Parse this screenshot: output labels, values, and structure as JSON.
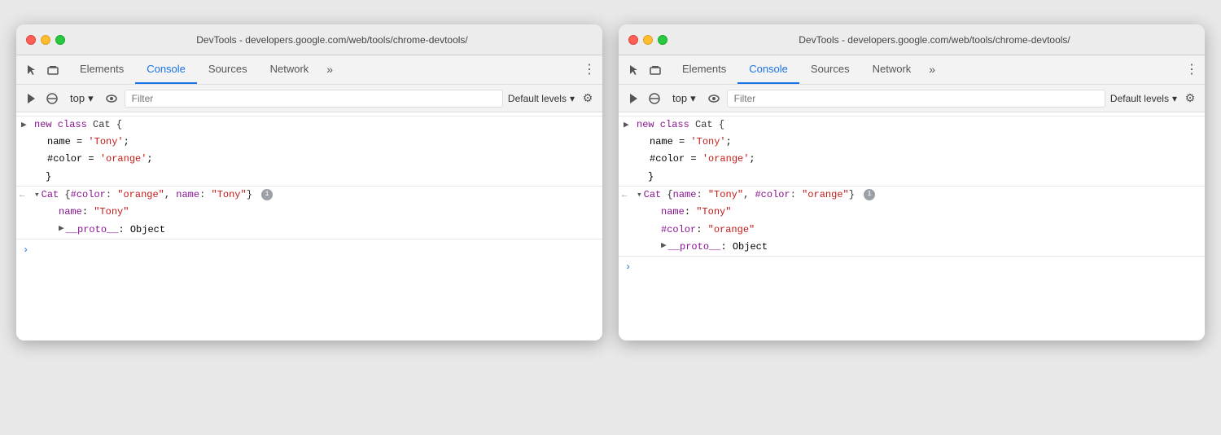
{
  "windows": [
    {
      "id": "window-left",
      "title_bar": {
        "title": "DevTools - developers.google.com/web/tools/chrome-devtools/"
      },
      "tabs": {
        "items": [
          {
            "id": "elements",
            "label": "Elements",
            "active": false
          },
          {
            "id": "console",
            "label": "Console",
            "active": true
          },
          {
            "id": "sources",
            "label": "Sources",
            "active": false
          },
          {
            "id": "network",
            "label": "Network",
            "active": false
          }
        ],
        "more_label": "»"
      },
      "toolbar": {
        "context_label": "top",
        "filter_placeholder": "Filter",
        "levels_label": "Default levels",
        "levels_arrow": "▾"
      },
      "console": {
        "input_lines": [
          "> new class Cat {",
          "    name = 'Tony';",
          "    #color = 'orange';",
          "  }"
        ],
        "output": {
          "arrow": "<",
          "expanded": true,
          "obj_preview_left": "▾Cat {#color: ",
          "obj_color_val": "\"orange\"",
          "obj_preview_mid": ", name: ",
          "obj_name_val": "\"Tony\"",
          "obj_preview_right": "}",
          "children": [
            {
              "key": "name",
              "value": "\"Tony\"",
              "value_type": "string"
            },
            {
              "proto_prefix": "▶",
              "proto_key": "__proto__",
              "proto_value": "Object"
            }
          ]
        }
      }
    },
    {
      "id": "window-right",
      "title_bar": {
        "title": "DevTools - developers.google.com/web/tools/chrome-devtools/"
      },
      "tabs": {
        "items": [
          {
            "id": "elements",
            "label": "Elements",
            "active": false
          },
          {
            "id": "console",
            "label": "Console",
            "active": true
          },
          {
            "id": "sources",
            "label": "Sources",
            "active": false
          },
          {
            "id": "network",
            "label": "Network",
            "active": false
          }
        ],
        "more_label": "»"
      },
      "toolbar": {
        "context_label": "top",
        "filter_placeholder": "Filter",
        "levels_label": "Default levels",
        "levels_arrow": "▾"
      },
      "console": {
        "input_lines": [
          "> new class Cat {",
          "    name = 'Tony';",
          "    #color = 'orange';",
          "  }"
        ],
        "output": {
          "arrow": "<",
          "expanded": true,
          "obj_preview_left": "▾Cat {name: ",
          "obj_name_val": "\"Tony\"",
          "obj_preview_mid": ", #color: ",
          "obj_color_val": "\"orange\"",
          "obj_preview_right": "}",
          "children": [
            {
              "key": "name",
              "value": "\"Tony\"",
              "value_type": "string"
            },
            {
              "key": "#color",
              "value": "\"orange\"",
              "value_type": "string"
            },
            {
              "proto_prefix": "▶",
              "proto_key": "__proto__",
              "proto_value": "Object"
            }
          ]
        }
      }
    }
  ],
  "icons": {
    "cursor": "⬚",
    "layers": "⬕",
    "pause": "⏵",
    "clear": "⊘",
    "eye": "👁",
    "gear": "⚙",
    "more_vert": "⋮",
    "info": "i"
  }
}
